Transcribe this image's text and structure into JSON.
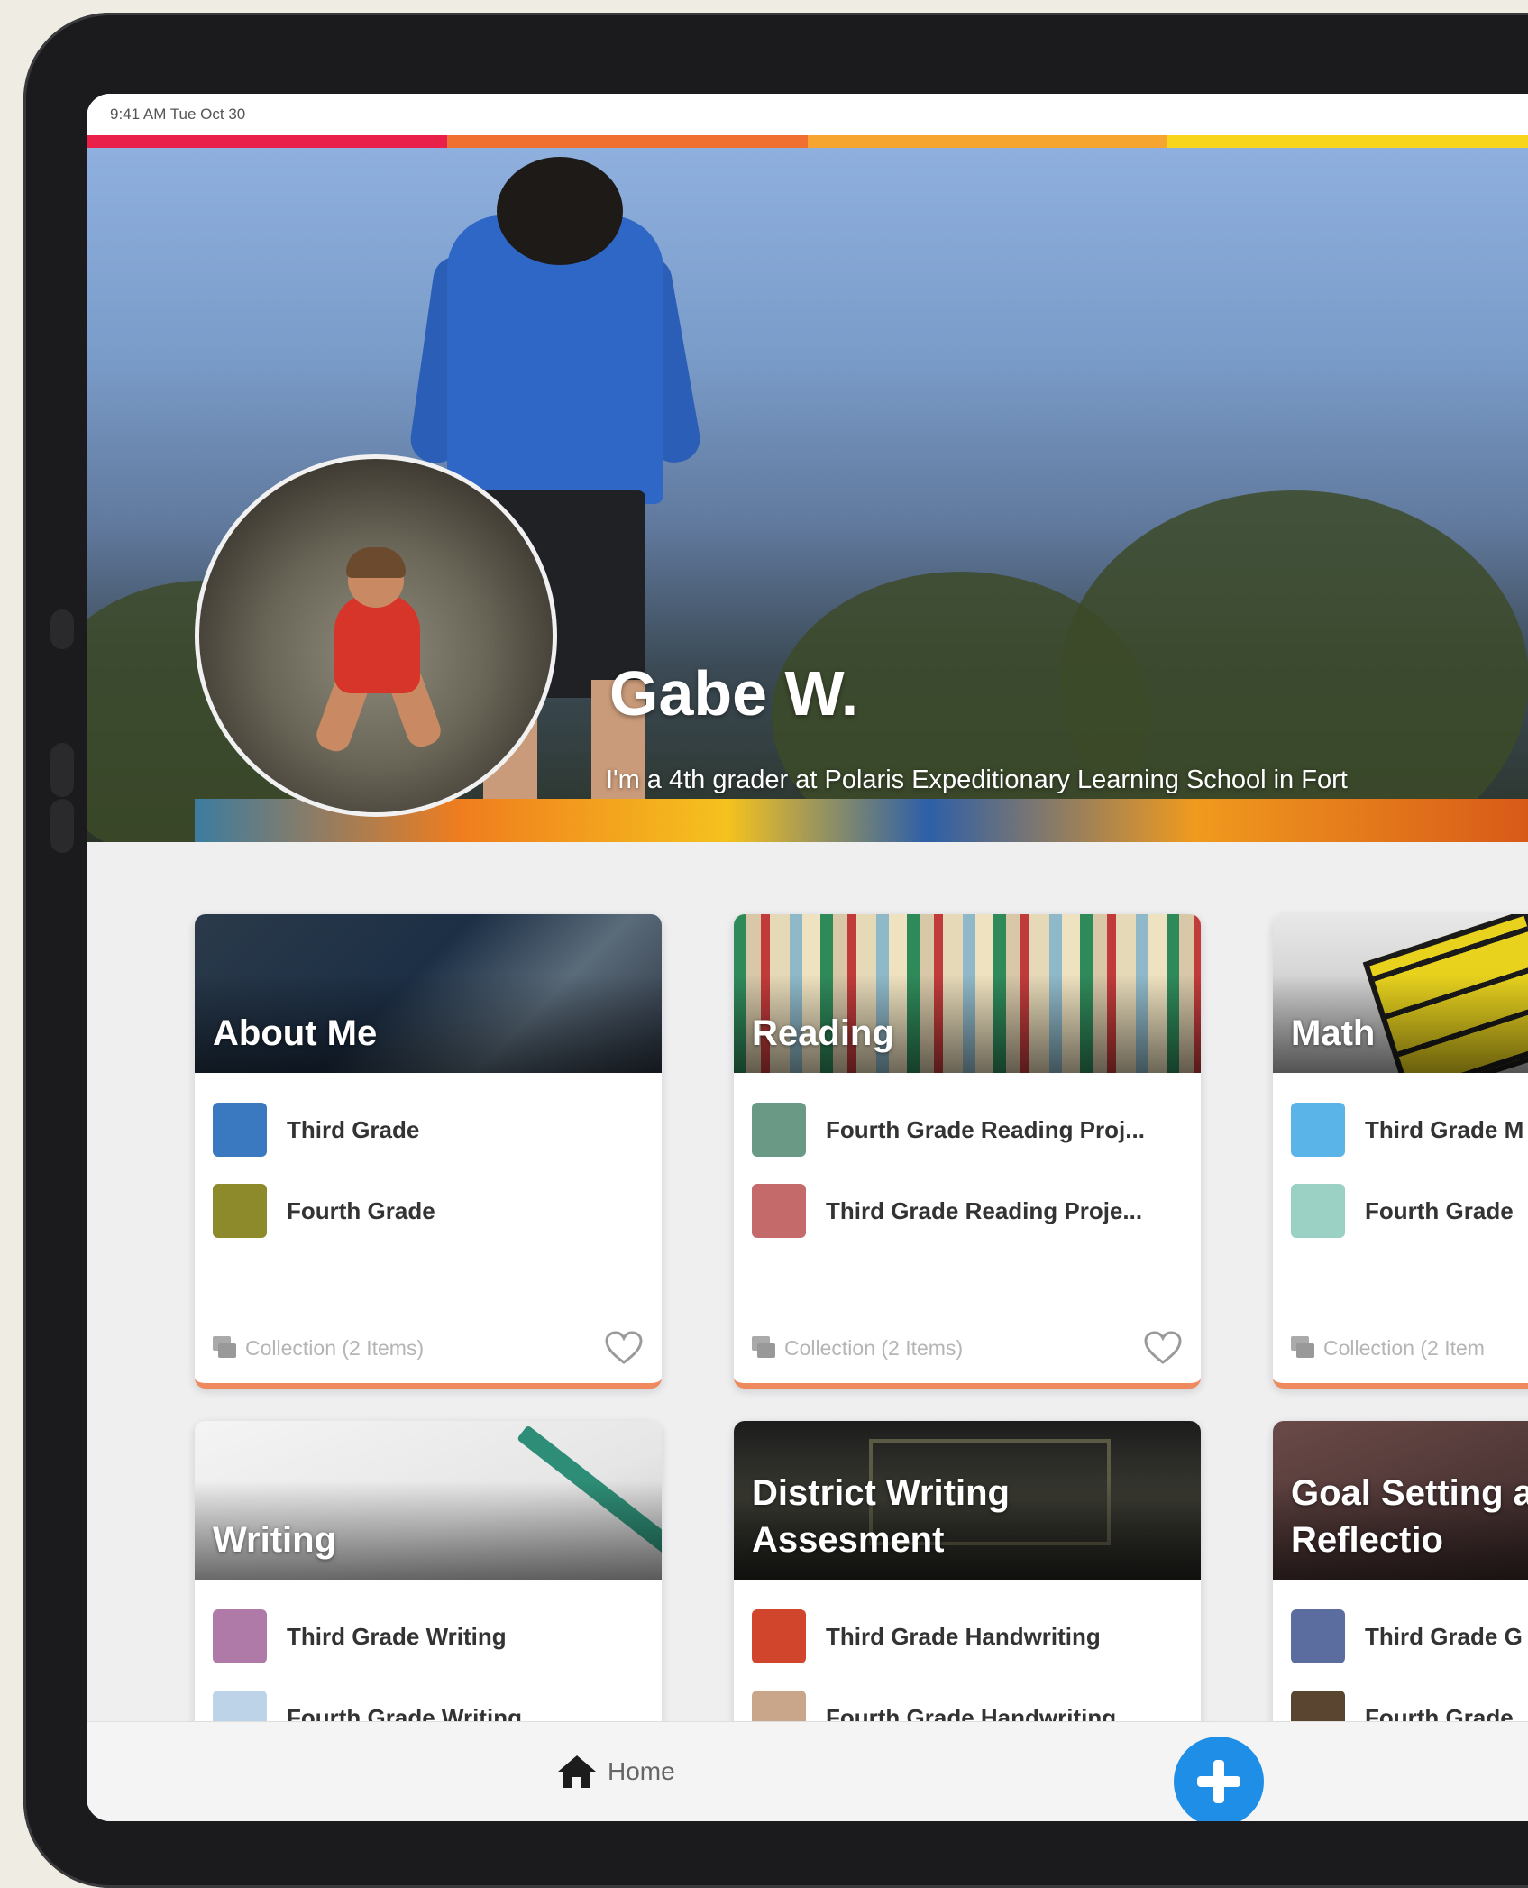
{
  "status_bar": {
    "time_date": "9:41 AM  Tue Oct 30"
  },
  "rainbow_colors": [
    "#e8204a",
    "#f07032",
    "#f7a531",
    "#f7d51c"
  ],
  "profile": {
    "name": "Gabe W.",
    "bio": "I'm a 4th grader at Polaris Expeditionary Learning School in Fort"
  },
  "cards": [
    {
      "title": "About Me",
      "items": [
        {
          "label": "Third Grade",
          "thumb_color": "#3a78c0"
        },
        {
          "label": "Fourth Grade",
          "thumb_color": "#8c8a2a"
        }
      ],
      "footer": "Collection (2 Items)"
    },
    {
      "title": "Reading",
      "items": [
        {
          "label": "Fourth Grade Reading Proj...",
          "thumb_color": "#6a9a86"
        },
        {
          "label": "Third Grade Reading Proje...",
          "thumb_color": "#c56a6a"
        }
      ],
      "footer": "Collection (2 Items)"
    },
    {
      "title": "Math",
      "items": [
        {
          "label": "Third Grade M",
          "thumb_color": "#5ab4e8"
        },
        {
          "label": "Fourth Grade",
          "thumb_color": "#9ad1c4"
        }
      ],
      "footer": "Collection (2 Item"
    },
    {
      "title": "Writing",
      "items": [
        {
          "label": "Third Grade Writing",
          "thumb_color": "#b07aa8"
        },
        {
          "label": "Fourth Grade Writing",
          "thumb_color": "#bcd3e8"
        }
      ]
    },
    {
      "title": "District Writing Assesment",
      "items": [
        {
          "label": "Third Grade Handwriting",
          "thumb_color": "#d2452d"
        },
        {
          "label": "Fourth Grade Handwriting",
          "thumb_color": "#c9a58a"
        }
      ]
    },
    {
      "title": "Goal Setting and Reflectio",
      "items": [
        {
          "label": "Third Grade G",
          "thumb_color": "#5b6c9e"
        },
        {
          "label": "Fourth Grade",
          "thumb_color": "#5a4530"
        }
      ]
    }
  ],
  "bottom_bar": {
    "home_label": "Home",
    "home_icon": "home-icon",
    "add_icon": "plus-icon",
    "accent": "#1e8ee6"
  }
}
